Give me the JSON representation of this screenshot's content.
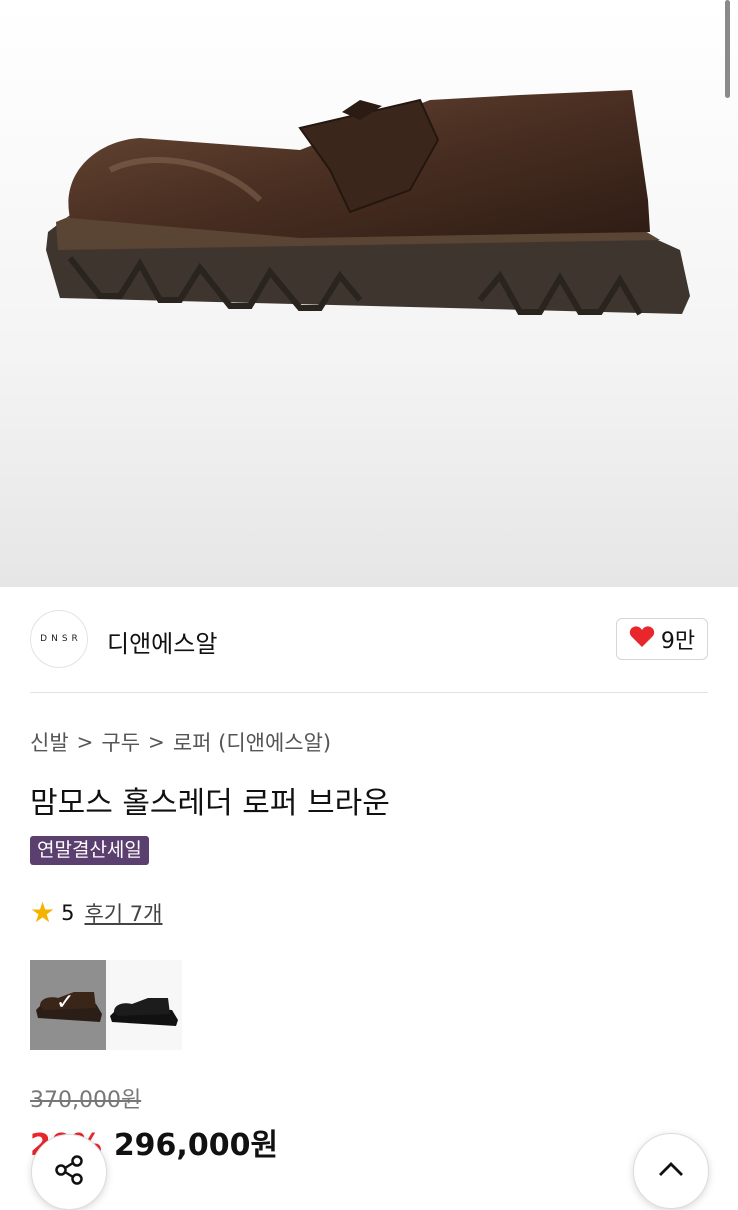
{
  "brand": {
    "logo_text": "DNSR",
    "name": "디앤에스알"
  },
  "like": {
    "icon": "heart-icon",
    "count": "9만",
    "color": "#e8262c"
  },
  "breadcrumb": {
    "items": [
      "신발",
      "구두",
      "로퍼 (디앤에스알)"
    ],
    "separator": ">"
  },
  "product": {
    "title": "맘모스 홀스레더 로퍼 브라운",
    "badge": "연말결산세일"
  },
  "rating": {
    "score": "5",
    "review_link": "후기 7개"
  },
  "variants": {
    "selected_index": 0,
    "options": [
      "brown-loafer-thumb",
      "black-loafer-thumb"
    ]
  },
  "price": {
    "original": "370,000원",
    "discount": "20%",
    "current": "296,000원"
  },
  "colors": {
    "badge_bg": "#5b3f6e",
    "discount": "#e8262c",
    "star": "#f5b300"
  }
}
